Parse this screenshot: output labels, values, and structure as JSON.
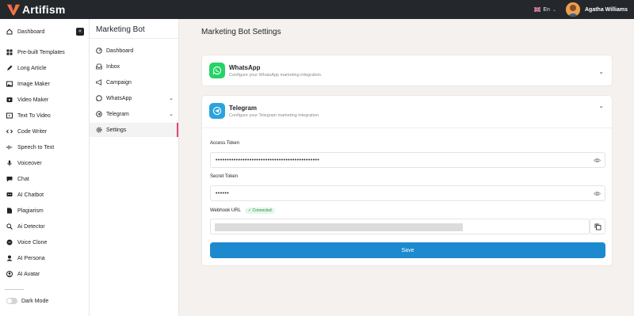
{
  "brand": {
    "name": "Artifism"
  },
  "topbar": {
    "language": "En",
    "user_name": "Agatha Williams"
  },
  "sidebar": {
    "collapse_label": "«",
    "items": [
      {
        "label": "Dashboard",
        "icon": "home-icon"
      },
      {
        "label": "Pre-built Templates",
        "icon": "grid-icon"
      },
      {
        "label": "Long Article",
        "icon": "pen-icon"
      },
      {
        "label": "Image Maker",
        "icon": "image-icon"
      },
      {
        "label": "Video Maker",
        "icon": "video-icon"
      },
      {
        "label": "Text To Video",
        "icon": "text-video-icon"
      },
      {
        "label": "Code Writer",
        "icon": "code-icon"
      },
      {
        "label": "Speech to Text",
        "icon": "speech-icon"
      },
      {
        "label": "Voiceover",
        "icon": "mic-icon"
      },
      {
        "label": "Chat",
        "icon": "chat-icon"
      },
      {
        "label": "AI Chatbot",
        "icon": "chatbot-icon"
      },
      {
        "label": "Plagiarism",
        "icon": "plagiarism-icon"
      },
      {
        "label": "Ai Detector",
        "icon": "detector-icon"
      },
      {
        "label": "Voice Clone",
        "icon": "voice-clone-icon"
      },
      {
        "label": "AI Persona",
        "icon": "persona-icon"
      },
      {
        "label": "AI Avatar",
        "icon": "avatar-icon"
      }
    ],
    "dark_mode_label": "Dark Mode"
  },
  "subnav": {
    "title": "Marketing Bot",
    "items": [
      {
        "label": "Dashboard",
        "icon": "dashboard-icon"
      },
      {
        "label": "Inbox",
        "icon": "inbox-icon"
      },
      {
        "label": "Campaign",
        "icon": "megaphone-icon"
      },
      {
        "label": "WhatsApp",
        "icon": "whatsapp-icon",
        "caret": "⌄"
      },
      {
        "label": "Telegram",
        "icon": "telegram-icon",
        "caret": "⌄"
      },
      {
        "label": "Settings",
        "icon": "gear-icon"
      }
    ]
  },
  "main": {
    "title": "Marketing Bot Settings",
    "whatsapp": {
      "title": "WhatsApp",
      "subtitle": "Configure your WhatsApp marketing integration.",
      "color": "#25d366"
    },
    "telegram": {
      "title": "Telegram",
      "subtitle": "Configure your Telegram marketing integration.",
      "color": "#2aa3dc",
      "access_token_label": "Access Token",
      "access_token_value": "••••••••••••••••••••••••••••••••••••••••••••••",
      "secret_token_label": "Secret Token",
      "secret_token_value": "••••••",
      "webhook_label": "Webhook URL",
      "webhook_status": "✓ Connected",
      "save_label": "Save"
    }
  },
  "colors": {
    "accent": "#1d8ad0",
    "active_indicator": "#e0457b",
    "topbar": "#24272b"
  }
}
